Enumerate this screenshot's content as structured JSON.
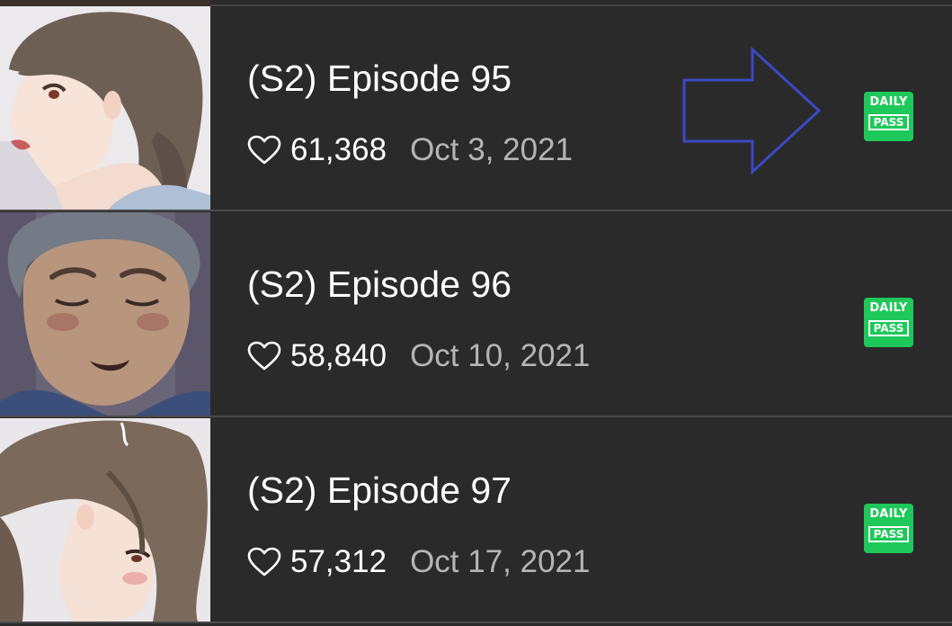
{
  "episodes": [
    {
      "title": "(S2) Episode 95",
      "likes": "61,368",
      "date": "Oct 3, 2021",
      "badge": {
        "line1": "DAILY",
        "line2": "PASS"
      }
    },
    {
      "title": "(S2) Episode 96",
      "likes": "58,840",
      "date": "Oct 10, 2021",
      "badge": {
        "line1": "DAILY",
        "line2": "PASS"
      }
    },
    {
      "title": "(S2) Episode 97",
      "likes": "57,312",
      "date": "Oct 17, 2021",
      "badge": {
        "line1": "DAILY",
        "line2": "PASS"
      }
    }
  ],
  "icons": {
    "like": "heart-outline-icon",
    "annotation": "arrow-right-outline"
  },
  "colors": {
    "background": "#2a2a2a",
    "divider": "#4a4a4a",
    "badge": "#1ec85a",
    "date_text": "#b5b5b5",
    "annotation_arrow": "#3b49c4"
  }
}
